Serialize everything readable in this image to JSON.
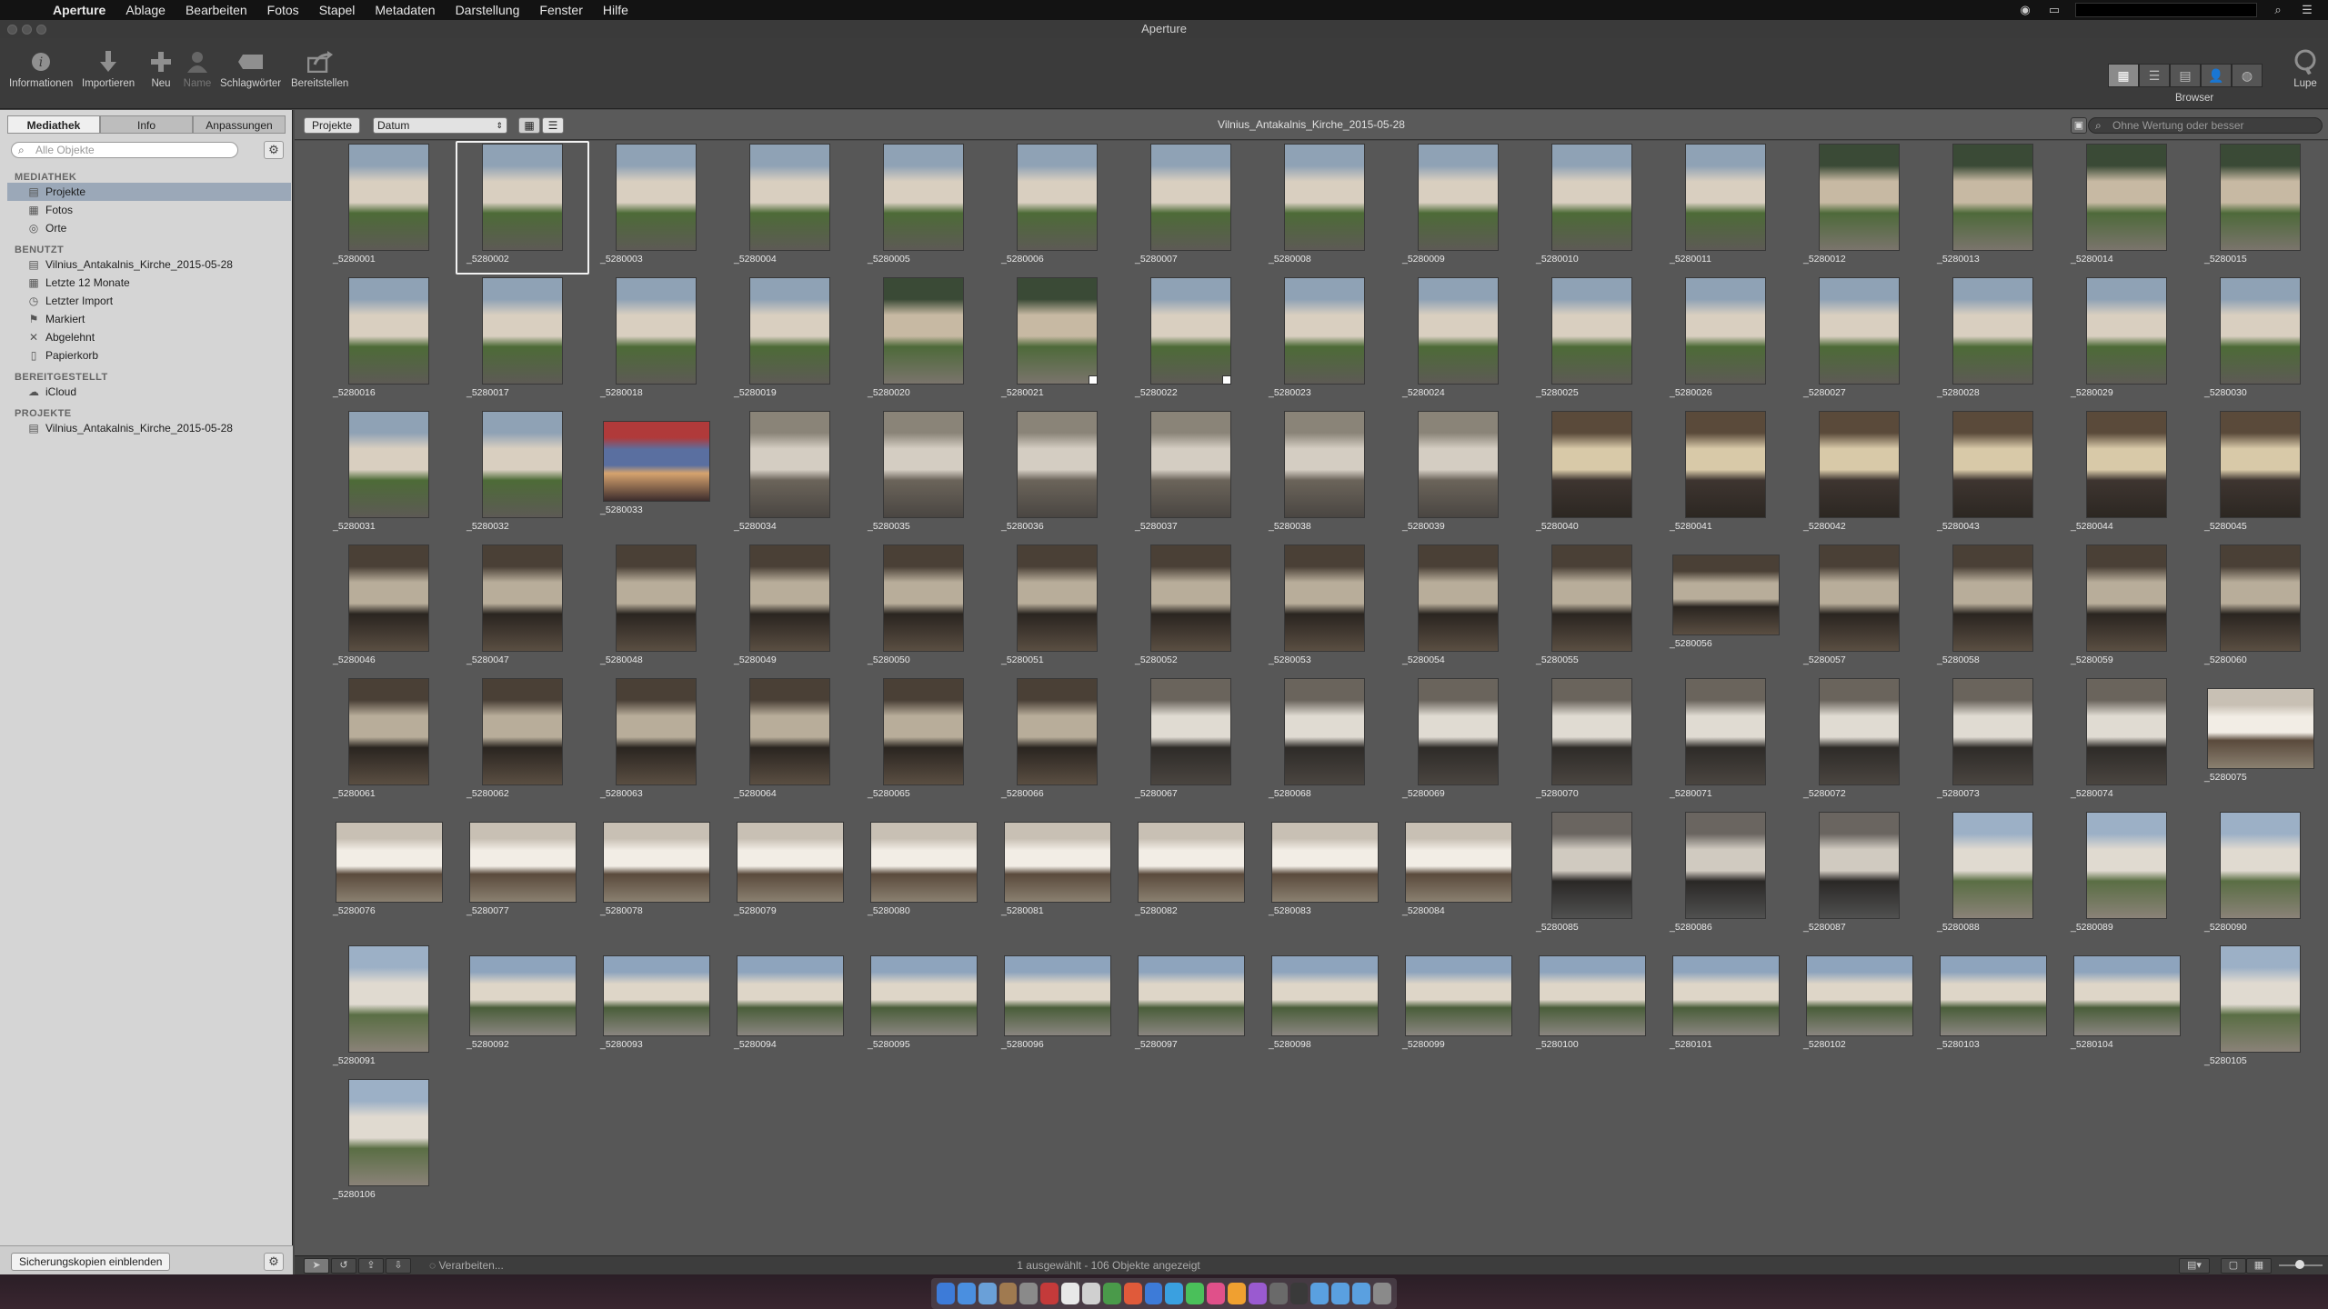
{
  "menubar": {
    "items": [
      "Aperture",
      "Ablage",
      "Bearbeiten",
      "Fotos",
      "Stapel",
      "Metadaten",
      "Darstellung",
      "Fenster",
      "Hilfe"
    ]
  },
  "window": {
    "title": "Aperture"
  },
  "toolbar": {
    "buttons": [
      {
        "label": "Informationen",
        "icon": "info-icon"
      },
      {
        "label": "Importieren",
        "icon": "import-icon"
      },
      {
        "label": "Neu",
        "icon": "plus-icon"
      },
      {
        "label": "Name",
        "icon": "person-icon"
      },
      {
        "label": "Schlagwörter",
        "icon": "tag-icon"
      },
      {
        "label": "Bereitstellen",
        "icon": "share-icon"
      }
    ],
    "right": {
      "browser_label": "Browser",
      "loupe_label": "Lupe"
    }
  },
  "sidebar": {
    "tabs": [
      "Mediathek",
      "Info",
      "Anpassungen"
    ],
    "search_placeholder": "Alle Objekte",
    "sections": [
      {
        "title": "MEDIATHEK",
        "items": [
          {
            "label": "Projekte",
            "icon": "projects-icon",
            "selected": true
          },
          {
            "label": "Fotos",
            "icon": "photos-icon"
          },
          {
            "label": "Orte",
            "icon": "places-icon"
          }
        ]
      },
      {
        "title": "BENUTZT",
        "items": [
          {
            "label": "Vilnius_Antakalnis_Kirche_2015-05-28",
            "icon": "project-icon"
          },
          {
            "label": "Letzte 12 Monate",
            "icon": "calendar-icon"
          },
          {
            "label": "Letzter Import",
            "icon": "clock-icon"
          },
          {
            "label": "Markiert",
            "icon": "flag-icon"
          },
          {
            "label": "Abgelehnt",
            "icon": "reject-icon"
          },
          {
            "label": "Papierkorb",
            "icon": "trash-icon"
          }
        ]
      },
      {
        "title": "BEREITGESTELLT",
        "items": [
          {
            "label": "iCloud",
            "icon": "cloud-icon"
          }
        ]
      },
      {
        "title": "PROJEKTE",
        "items": [
          {
            "label": "Vilnius_Antakalnis_Kirche_2015-05-28",
            "icon": "project-icon"
          }
        ]
      }
    ],
    "bottom_button": "Sicherungskopien einblenden"
  },
  "browser": {
    "projects_button": "Projekte",
    "sort_select": "Datum",
    "title": "Vilnius_Antakalnis_Kirche_2015-05-28",
    "filter_placeholder": "Ohne Wertung oder besser",
    "selected_index": 1
  },
  "thumbs_prefix": "_52800",
  "status": {
    "processing": "Verarbeiten...",
    "summary": "1 ausgewählt - 106 Objekte angezeigt"
  }
}
